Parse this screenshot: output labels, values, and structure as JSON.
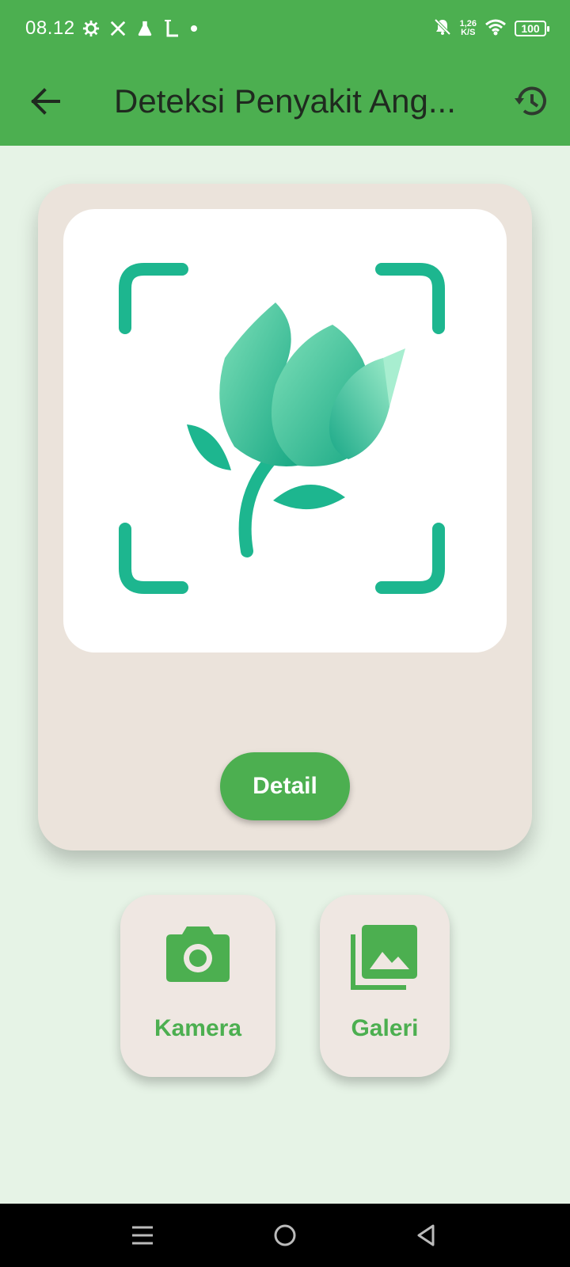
{
  "status_bar": {
    "time": "08.12",
    "left_icons": [
      "gear-icon",
      "x-logo-icon",
      "flask-icon",
      "l-icon",
      "dot-icon"
    ],
    "speed_value": "1,26",
    "speed_unit": "K/S",
    "battery": "100"
  },
  "app_bar": {
    "title": "Deteksi Penyakit Ang...",
    "back_icon": "arrow-left-icon",
    "history_icon": "history-icon"
  },
  "card": {
    "image": "plant-scan-icon",
    "detail_label": "Detail"
  },
  "actions": {
    "camera_label": "Kamera",
    "camera_icon": "camera-icon",
    "gallery_label": "Galeri",
    "gallery_icon": "gallery-icon"
  },
  "nav": {
    "items": [
      "menu-icon",
      "home-icon",
      "back-icon"
    ]
  },
  "colors": {
    "primary": "#4caf50",
    "background": "#e6f3e6",
    "card": "#ebe3db",
    "plant_teal": "#1db68f"
  }
}
